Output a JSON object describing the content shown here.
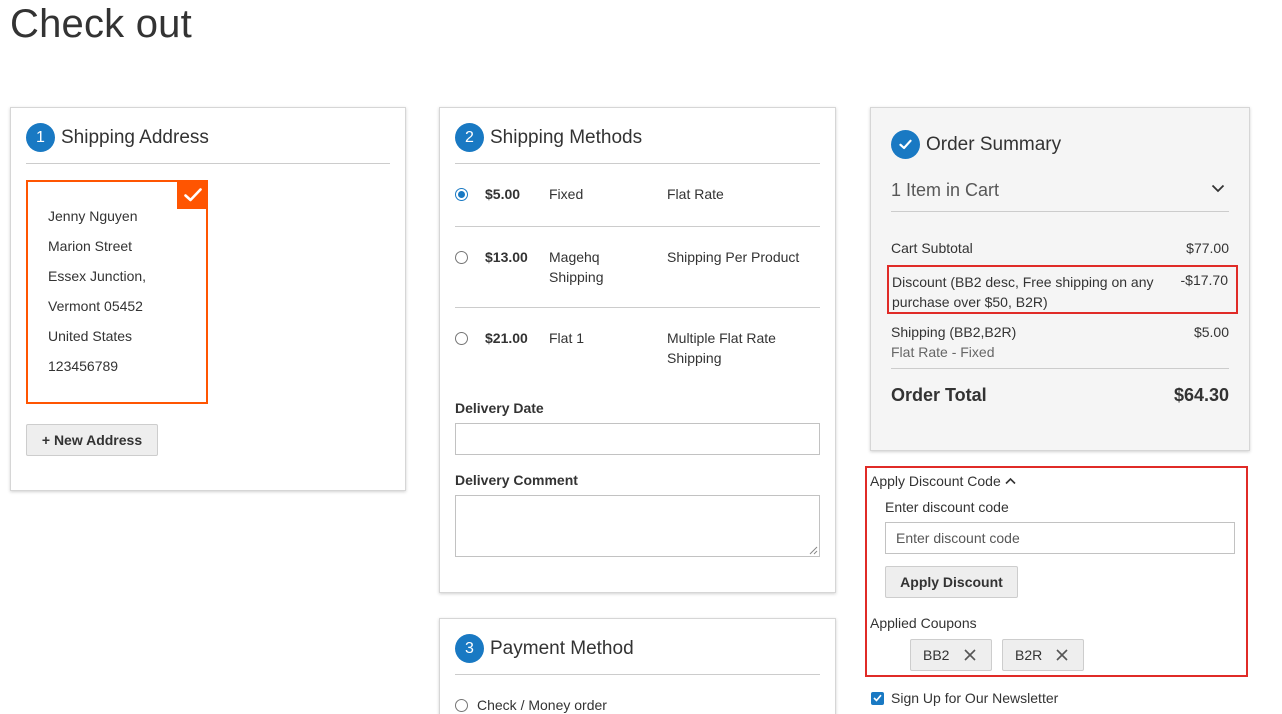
{
  "page": {
    "title": "Check out"
  },
  "shipping_address": {
    "step": "1",
    "title": "Shipping Address",
    "address_lines": [
      "Jenny Nguyen",
      "Marion Street",
      "Essex Junction,",
      "Vermont 05452",
      "United States",
      "123456789"
    ],
    "new_address_label": "+ New Address"
  },
  "shipping_methods": {
    "step": "2",
    "title": "Shipping Methods",
    "rows": [
      {
        "price": "$5.00",
        "method": "Fixed",
        "carrier": "Flat Rate",
        "selected": true
      },
      {
        "price": "$13.00",
        "method": "Magehq Shipping",
        "carrier": "Shipping Per Product",
        "selected": false
      },
      {
        "price": "$21.00",
        "method": "Flat 1",
        "carrier": "Multiple Flat Rate Shipping",
        "selected": false
      }
    ],
    "delivery_date_label": "Delivery Date",
    "delivery_comment_label": "Delivery Comment"
  },
  "payment_method": {
    "step": "3",
    "title": "Payment Method",
    "option": "Check / Money order"
  },
  "order_summary": {
    "title": "Order Summary",
    "items_in_cart": "1 Item in Cart",
    "subtotal_label": "Cart Subtotal",
    "subtotal_value": "$77.00",
    "discount_label": "Discount (BB2 desc, Free shipping on any purchase over $50, B2R)",
    "discount_value": "-$17.70",
    "shipping_label": "Shipping (BB2,B2R)",
    "shipping_sub": "Flat Rate - Fixed",
    "shipping_value": "$5.00",
    "total_label": "Order Total",
    "total_value": "$64.30"
  },
  "discount": {
    "title": "Apply Discount Code",
    "field_label": "Enter discount code",
    "placeholder": "Enter discount code",
    "apply_label": "Apply Discount",
    "applied_label": "Applied Coupons",
    "coupons": [
      "BB2",
      "B2R"
    ]
  },
  "newsletter": {
    "label": "Sign Up for Our Newsletter",
    "checked": true
  },
  "colors": {
    "accent": "#1979c3",
    "selected_border": "#ff5501",
    "highlight": "#e02b27"
  },
  "icons": [
    "check-icon",
    "chevron-down-icon",
    "chevron-up-icon",
    "close-icon"
  ]
}
